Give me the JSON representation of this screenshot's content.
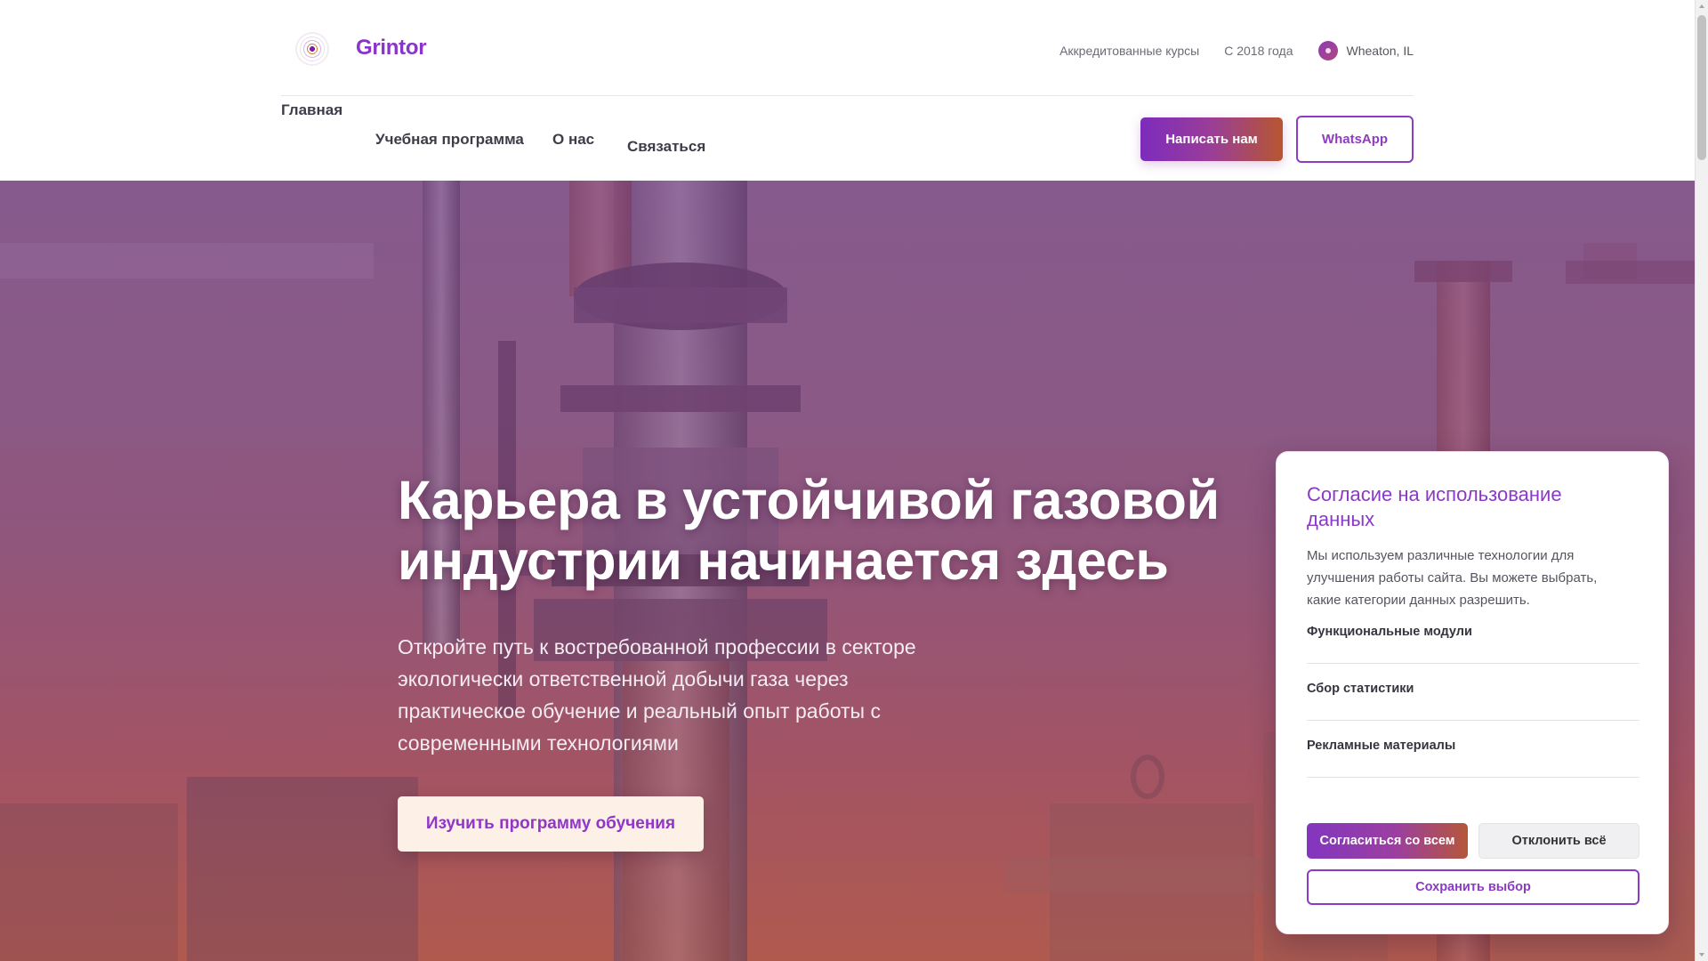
{
  "header": {
    "brand": "Grintor",
    "meta": {
      "accredited": "Аккредитованные курсы",
      "since": "С 2018 года",
      "location": "Wheaton, IL"
    },
    "nav": [
      {
        "label": "Главная"
      },
      {
        "label": "Учебная программа"
      },
      {
        "label": "О нас"
      },
      {
        "label": "Связаться"
      }
    ],
    "write_button": "Написать нам",
    "whatsapp_button": "WhatsApp"
  },
  "hero": {
    "title": "Карьера в устойчивой газовой индустрии начинается здесь",
    "subtitle": "Откройте путь к востребованной профессии в секторе экологически ответственной добычи газа через практическое обучение и реальный опыт работы с современными технологиями",
    "cta": "Изучить программу обучения"
  },
  "consent": {
    "title": "Согласие на использование данных",
    "description": "Мы используем различные технологии для улучшения работы сайта. Вы можете выбрать, какие категории данных разрешить.",
    "categories": [
      {
        "label": "Функциональные модули"
      },
      {
        "label": "Сбор статистики"
      },
      {
        "label": "Рекламные материалы"
      }
    ],
    "accept_all": "Согласиться со всем",
    "decline_all": "Отклонить всё",
    "save": "Сохранить выбор"
  },
  "colors": {
    "brand_purple": "#8a35c9",
    "accent_orange": "#b65630",
    "hero_overlay": "#93627f"
  },
  "icons": {
    "logo": "concentric-circles-logo",
    "location": "location-pin-icon"
  }
}
